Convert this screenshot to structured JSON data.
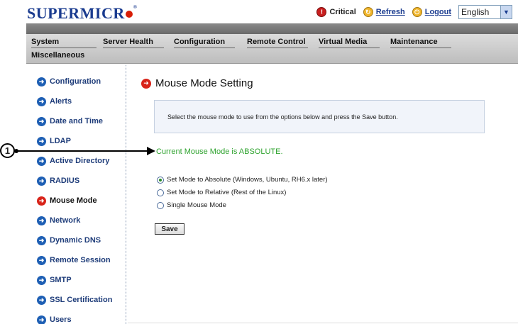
{
  "header": {
    "logo_text": "SUPERMICR",
    "logo_reg": "®",
    "critical_label": "Critical",
    "refresh_label": "Refresh",
    "logout_label": "Logout",
    "language": "English"
  },
  "nav": {
    "tabs": [
      "System",
      "Server Health",
      "Configuration",
      "Remote Control",
      "Virtual Media",
      "Maintenance",
      "Miscellaneous"
    ]
  },
  "sidebar": {
    "items": [
      {
        "label": "Configuration",
        "active": false
      },
      {
        "label": "Alerts",
        "active": false
      },
      {
        "label": "Date and Time",
        "active": false
      },
      {
        "label": "LDAP",
        "active": false
      },
      {
        "label": "Active Directory",
        "active": false
      },
      {
        "label": "RADIUS",
        "active": false
      },
      {
        "label": "Mouse Mode",
        "active": true
      },
      {
        "label": "Network",
        "active": false
      },
      {
        "label": "Dynamic DNS",
        "active": false
      },
      {
        "label": "Remote Session",
        "active": false
      },
      {
        "label": "SMTP",
        "active": false
      },
      {
        "label": "SSL Certification",
        "active": false
      },
      {
        "label": "Users",
        "active": false
      }
    ]
  },
  "main": {
    "title": "Mouse Mode Setting",
    "instructions": "Select the mouse mode to use from the options below and press the Save button.",
    "current_mode": "Current Mouse Mode is ABSOLUTE.",
    "options": [
      {
        "label": "Set Mode to Absolute (Windows, Ubuntu, RH6.x later)",
        "selected": true
      },
      {
        "label": "Set Mode to Relative (Rest of the Linux)",
        "selected": false
      },
      {
        "label": "Single Mouse Mode",
        "selected": false
      }
    ],
    "save_label": "Save"
  },
  "callout": {
    "number": "1"
  },
  "colors": {
    "brand_blue": "#1a3b8f",
    "brand_red": "#d81e05",
    "status_green": "#2fa32f"
  }
}
